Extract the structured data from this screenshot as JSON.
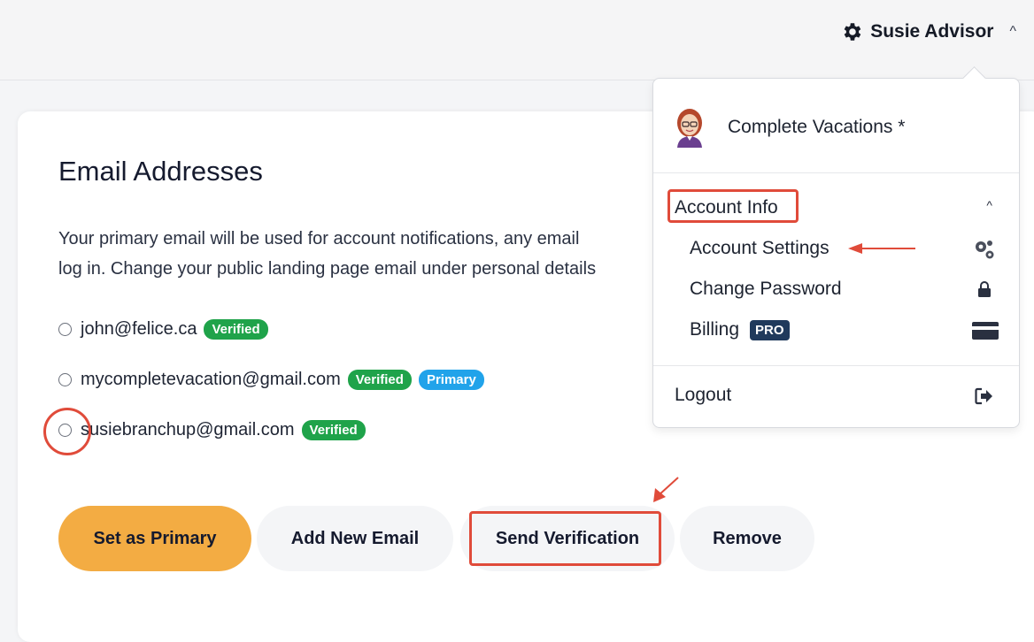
{
  "header": {
    "user_name": "Susie Advisor",
    "caret": "^"
  },
  "email_section": {
    "title": "Email Addresses",
    "description_line1": "Your primary email will be used for account notifications, any email",
    "description_line2": "log in. Change your public landing page email under personal details",
    "emails": [
      {
        "address": "john@felice.ca",
        "badges": [
          "Verified"
        ]
      },
      {
        "address": "mycompletevacation@gmail.com",
        "badges": [
          "Verified",
          "Primary"
        ]
      },
      {
        "address": "susiebranchup@gmail.com",
        "badges": [
          "Verified"
        ]
      }
    ],
    "buttons": {
      "set_primary": "Set as Primary",
      "add_new": "Add New Email",
      "send_verification": "Send Verification",
      "remove": "Remove"
    }
  },
  "dropdown": {
    "company": "Complete Vacations *",
    "account_info": "Account Info",
    "items": [
      {
        "label": "Account Settings",
        "icon": "gears-icon"
      },
      {
        "label": "Change Password",
        "icon": "lock-icon"
      },
      {
        "label": "Billing",
        "badge": "PRO",
        "icon": "credit-card-icon"
      }
    ],
    "logout": "Logout"
  },
  "colors": {
    "verified": "#1fa34a",
    "primary": "#21a3ea",
    "set_primary_button": "#f3ac43",
    "annotation": "#e04b3a",
    "pro_badge": "#203a5c"
  }
}
